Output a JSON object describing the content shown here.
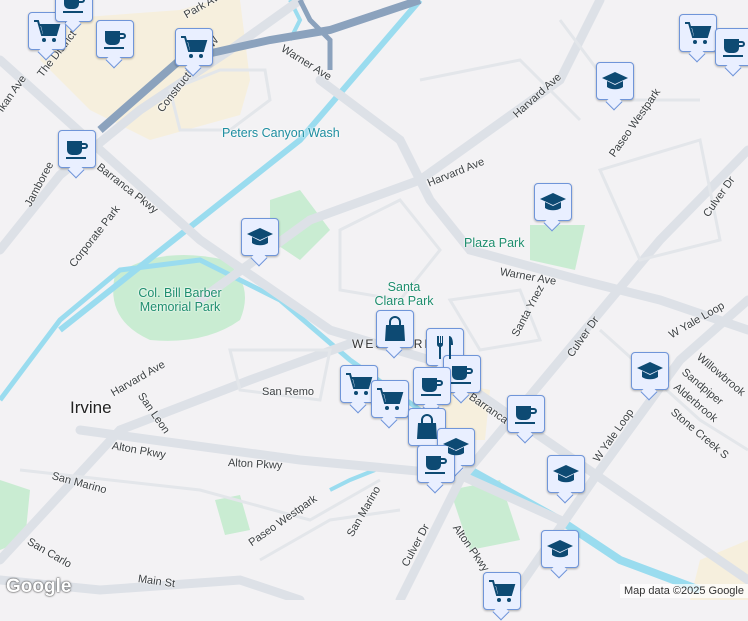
{
  "map": {
    "city": "Irvine",
    "area": "WESTPARK",
    "parks": [
      "Peters Canyon Wash",
      "Col. Bill Barber Memorial Park",
      "Plaza Park",
      "Santa Clara Park"
    ],
    "streets": [
      "Warner Ave",
      "Park Ave",
      "The District",
      "Construction Cir W",
      "Harvard Ave",
      "Harvard Ave",
      "Jamboree",
      "Barranca Pkwy",
      "Corporate Park",
      "Warner Ave",
      "Santa Ynez",
      "Culver Dr",
      "Culver Dr",
      "Culver Dr",
      "W Yale Loop",
      "W Yale Loop",
      "Willowbrook",
      "Sandpiper",
      "Alderbrook",
      "Stone Creek S",
      "Paseo Westpark",
      "Paseo Westpark",
      "Alton Pkwy",
      "Alton Pkwy",
      "Alton Pkwy",
      "San Remo",
      "San Leon",
      "San Marino",
      "San Marino",
      "San Carlo",
      "Main St",
      "Harvard Ave",
      "Barranca Pkwy",
      "Ikan Ave",
      "Paseo Westpark",
      "Yale Loop",
      "Alton Pkwy",
      "Peters Canyon Wash"
    ],
    "markers": [
      "cart",
      "coffee",
      "coffee",
      "cart",
      "coffee",
      "graduation-cap",
      "graduation-cap",
      "cart",
      "coffee",
      "graduation-cap",
      "shopping-bag",
      "restaurant",
      "coffee",
      "cart",
      "cart",
      "coffee",
      "shopping-bag",
      "graduation-cap",
      "coffee",
      "coffee",
      "graduation-cap",
      "graduation-cap",
      "graduation-cap",
      "cart"
    ]
  },
  "footer": {
    "logo": "Google",
    "attribution": "Map data ©2025 Google"
  },
  "colors": {
    "marker_bg": "#e9efff",
    "marker_border": "#6f95d9",
    "icon": "#0d4a73",
    "water": "#9adcef",
    "park": "#c9ecd2"
  }
}
